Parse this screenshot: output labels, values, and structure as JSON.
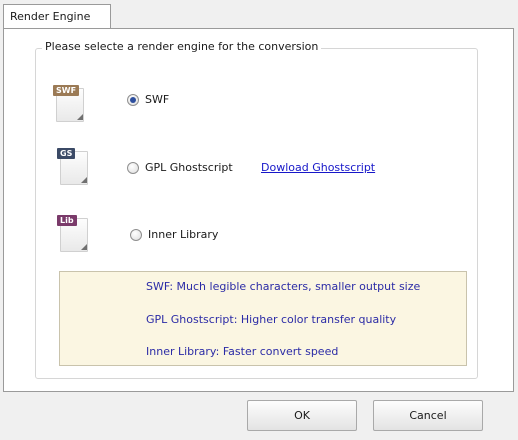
{
  "tabs": [
    {
      "label": "Render Engine"
    }
  ],
  "group": {
    "title": "Please selecte a render engine for the conversion"
  },
  "engines": [
    {
      "icon": "swf-file-icon",
      "tag": "SWF",
      "tag_color": "#9b7a55",
      "label": "SWF",
      "selected": true
    },
    {
      "icon": "gs-file-icon",
      "tag": "GS",
      "tag_color": "#3b4a66",
      "label": "GPL Ghostscript",
      "selected": false,
      "link": "Dowload Ghostscript"
    },
    {
      "icon": "lib-file-icon",
      "tag": "Lib",
      "tag_color": "#7a3a6a",
      "label": "Inner Library",
      "selected": false
    }
  ],
  "info": [
    "SWF: Much legible characters, smaller output size",
    "GPL Ghostscript: Higher color transfer quality",
    "Inner Library: Faster convert speed"
  ],
  "buttons": {
    "ok": "OK",
    "cancel": "Cancel"
  },
  "colors": {
    "link": "#1717c9",
    "info_bg": "#fbf6e2",
    "info_text": "#2b2ba6",
    "radio_dot": "#2d4f9e"
  }
}
